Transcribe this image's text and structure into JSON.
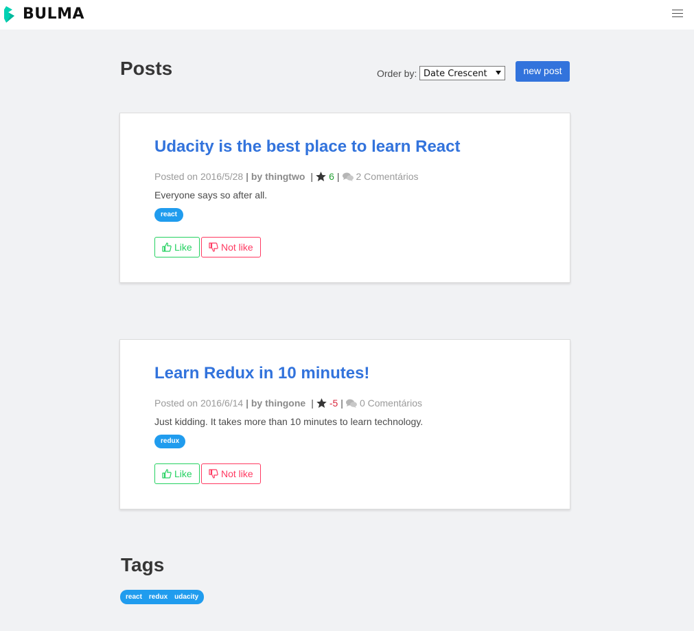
{
  "navbar": {
    "brand": "BULMA"
  },
  "header": {
    "title": "Posts",
    "order_label": "Order by:",
    "order_selected": "Date Crescent",
    "new_post_label": "new post"
  },
  "posts": [
    {
      "title": "Udacity is the best place to learn React",
      "posted_on": "Posted on 2016/5/28",
      "by": "by thingtwo",
      "score": "6",
      "comments": "2 Comentários",
      "body": "Everyone says so after all.",
      "tag": "react",
      "like_label": "Like",
      "unlike_label": "Not like"
    },
    {
      "title": "Learn Redux in 10 minutes!",
      "posted_on": "Posted on 2016/6/14",
      "by": "by thingone",
      "score": "-5",
      "comments": "0 Comentários",
      "body": "Just kidding. It takes more than 10 minutes to learn technology.",
      "tag": "redux",
      "like_label": "Like",
      "unlike_label": "Not like"
    }
  ],
  "tags_section": {
    "title": "Tags",
    "tags": [
      "react",
      "redux",
      "udacity"
    ]
  },
  "colors": {
    "primary": "#3273dc",
    "info": "#209cee",
    "success": "#23d160",
    "danger": "#ff3860",
    "brand_teal": "#00d1b2"
  },
  "icons": [
    "bulma-logo-icon",
    "hamburger-menu-icon",
    "star-icon",
    "comments-icon",
    "thumbs-up-icon",
    "thumbs-down-icon"
  ]
}
